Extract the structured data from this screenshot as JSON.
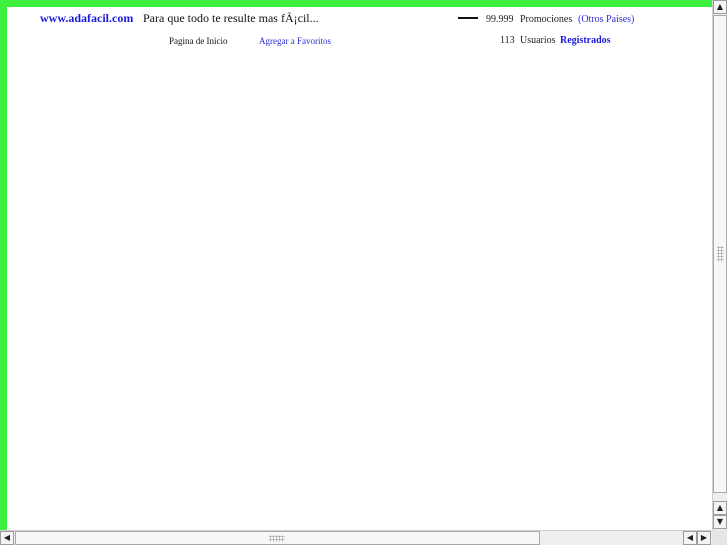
{
  "header": {
    "site_link": "www.adafacil.com",
    "tagline": "Para que todo te resulte mas fÃ¡cil..."
  },
  "nav": {
    "home_label": "Pagina de Inicio",
    "favorites_label": "Agregar a Favoritos"
  },
  "stats": {
    "promotions_count": "99.999",
    "promotions_label": "Promociones",
    "other_countries_link": "(Otros Paises)",
    "users_count": "113",
    "users_label": "Usuarios",
    "registered_link": "Registrados"
  },
  "scrollbars": {
    "up_arrow": "▲",
    "down_arrow": "▼",
    "left_arrow": "◀",
    "right_arrow": "▶"
  },
  "colors": {
    "page_border": "#3df03d",
    "link_blue": "#1a1adf"
  }
}
